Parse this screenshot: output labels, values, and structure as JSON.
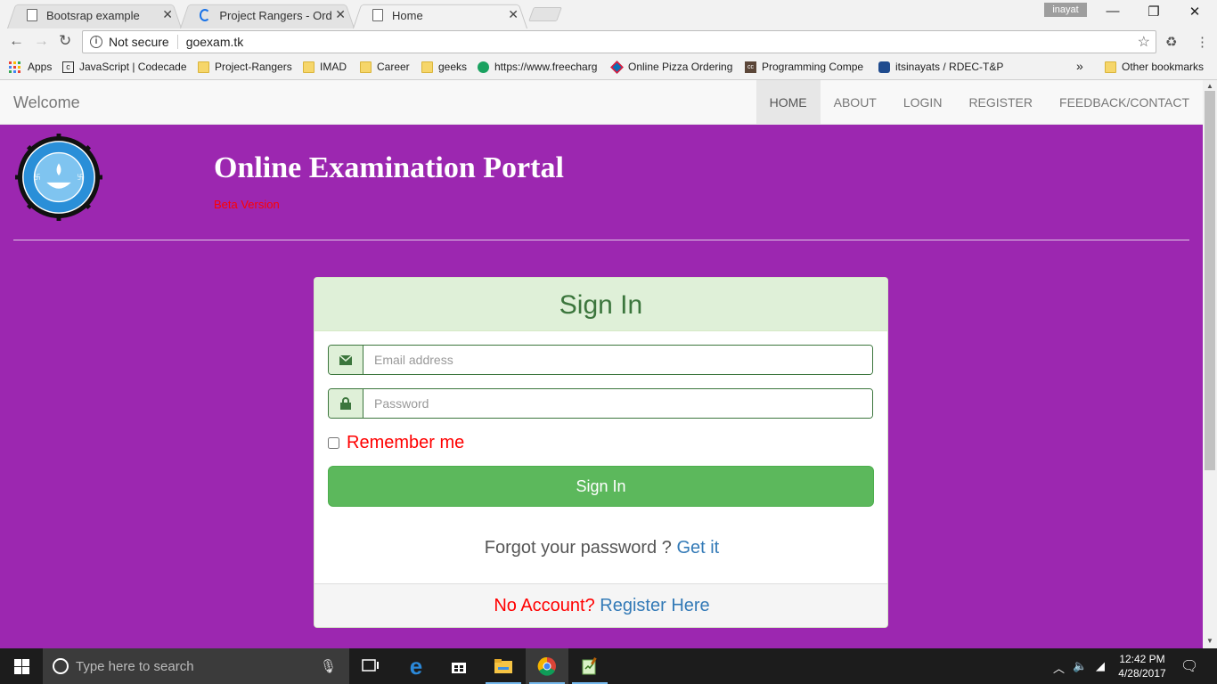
{
  "browser": {
    "tabs": [
      {
        "title": "Bootsrap example",
        "icon": "page-icon"
      },
      {
        "title": "Project Rangers - Order P",
        "icon": "loading-spinner-icon"
      },
      {
        "title": "Home",
        "icon": "page-icon"
      }
    ],
    "profile_name": "inayat",
    "window_controls": {
      "minimize": "—",
      "restore": "❐",
      "close": "✕"
    },
    "security_label": "Not secure",
    "url": "goexam.tk",
    "bookmarks": [
      {
        "label": "Apps",
        "icon": "apps-grid-icon"
      },
      {
        "label": "JavaScript | Codecade",
        "icon": "codecademy-icon"
      },
      {
        "label": "Project-Rangers",
        "icon": "folder-icon"
      },
      {
        "label": "IMAD",
        "icon": "folder-icon"
      },
      {
        "label": "Career",
        "icon": "folder-icon"
      },
      {
        "label": "geeks",
        "icon": "folder-icon"
      },
      {
        "label": "https://www.freecharg",
        "icon": "freecharge-icon"
      },
      {
        "label": "Online Pizza Ordering",
        "icon": "dominos-icon"
      },
      {
        "label": "Programming Compe",
        "icon": "codechef-icon"
      },
      {
        "label": "itsinayats / RDEC-T&P",
        "icon": "github-icon"
      }
    ],
    "bookmarks_overflow": "»",
    "other_bookmarks": "Other bookmarks"
  },
  "site": {
    "brand": "Welcome",
    "nav": [
      {
        "label": "HOME",
        "active": true
      },
      {
        "label": "ABOUT",
        "active": false
      },
      {
        "label": "LOGIN",
        "active": false
      },
      {
        "label": "REGISTER",
        "active": false
      },
      {
        "label": "FEEDBACK/CONTACT",
        "active": false
      }
    ],
    "title": "Online Examination Portal",
    "subtitle": "Beta Version",
    "logo_text": {
      "top": "R. D. ENGINEERING COLLEGE",
      "bottom": "GHAZIABAD"
    },
    "background_color": "#9c27b0"
  },
  "signin": {
    "heading": "Sign In",
    "email_placeholder": "Email address",
    "email_value": "",
    "password_placeholder": "Password",
    "password_value": "",
    "remember_label": "Remember me",
    "remember_checked": false,
    "button_label": "Sign In",
    "forgot_text": "Forgot your password ?",
    "forgot_link": "Get it",
    "no_account_text": "No Account?",
    "register_link": "Register Here"
  },
  "taskbar": {
    "search_placeholder": "Type here to search",
    "time": "12:42 PM",
    "date": "4/28/2017"
  }
}
